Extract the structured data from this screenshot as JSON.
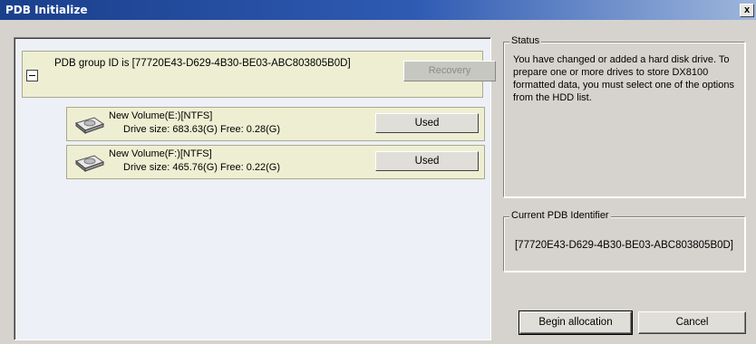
{
  "window": {
    "title": "PDB Initialize",
    "close_label": "x"
  },
  "group": {
    "label": "PDB group ID is [77720E43-D629-4B30-BE03-ABC803805B0D]",
    "recovery_label": "Recovery"
  },
  "drives": [
    {
      "name": "New Volume(E:)[NTFS]",
      "size": "Drive size: 683.63(G) Free: 0.28(G)",
      "button": "Used"
    },
    {
      "name": "New Volume(F:)[NTFS]",
      "size": "Drive size: 465.76(G) Free: 0.22(G)",
      "button": "Used"
    }
  ],
  "status": {
    "legend": "Status",
    "lines": [
      "You have changed or added a hard disk drive. To",
      "prepare one or more drives to store DX8100",
      "formatted data, you must select one of the options",
      "from the HDD list."
    ]
  },
  "current_pdb": {
    "legend": "Current PDB Identifier",
    "value": "[77720E43-D629-4B30-BE03-ABC803805B0D]"
  },
  "buttons": {
    "begin": "Begin allocation",
    "cancel": "Cancel"
  },
  "icons": {
    "collapse": "minus-box-icon",
    "drive": "hard-disk-icon",
    "close": "close-icon"
  }
}
